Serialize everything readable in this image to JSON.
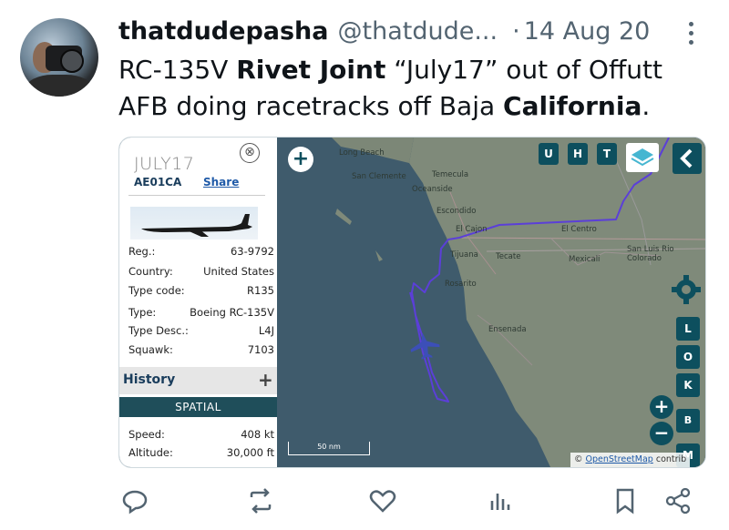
{
  "tweet": {
    "display_name": "thatdudepasha",
    "handle": "@thatdude...",
    "separator": "·",
    "date": "14 Aug 20",
    "text_parts": [
      "RC-135V ",
      "Rivet Joint",
      " “July17” out of Offutt AFB doing racetracks off Baja ",
      "California",
      "."
    ]
  },
  "panel": {
    "callsign": "JULY17",
    "hex": "AE01CA",
    "share_label": "Share",
    "close_symbol": "⊗",
    "details": [
      {
        "label": "Reg.:",
        "value": "63-9792"
      },
      {
        "label": "Country:",
        "value": "United States"
      },
      {
        "label": "Type code:",
        "value": "R135"
      },
      {
        "label": "Type:",
        "value": "Boeing RC-135V"
      },
      {
        "label": "Type Desc.:",
        "value": "L4J"
      },
      {
        "label": "Squawk:",
        "value": "7103"
      }
    ],
    "history_label": "History",
    "history_symbol": "+",
    "spatial_label": "SPATIAL",
    "spatial": [
      {
        "label": "Speed:",
        "value": "408 kt"
      },
      {
        "label": "Altitude:",
        "value": "30,000 ft"
      }
    ]
  },
  "map": {
    "place_labels": [
      "Long Beach",
      "San Clemente",
      "Temecula",
      "Oceanside",
      "Escondido",
      "El Cajon",
      "Tijuana",
      "Tecate",
      "Rosarito",
      "El Centro",
      "Mexicali",
      "San Luis Rio Colorado",
      "Ensenada"
    ],
    "top_buttons": [
      "U",
      "H",
      "T"
    ],
    "side_buttons": [
      "L",
      "O",
      "K",
      "B",
      "M"
    ],
    "zoom_in": "+",
    "zoom_out": "−",
    "add_symbol": "+",
    "scale_label": "50 nm",
    "attribution_prefix": "© ",
    "attribution_link": "OpenStreetMap",
    "attribution_suffix": " contrib",
    "colors": {
      "track": "#5b3fd8",
      "water": "#3f5b6c",
      "land": "#7f8a7a",
      "control": "#0d4f5e"
    }
  },
  "actions": [
    "reply-icon",
    "retweet-icon",
    "like-icon",
    "views-icon",
    "bookmark-icon",
    "share-icon"
  ]
}
